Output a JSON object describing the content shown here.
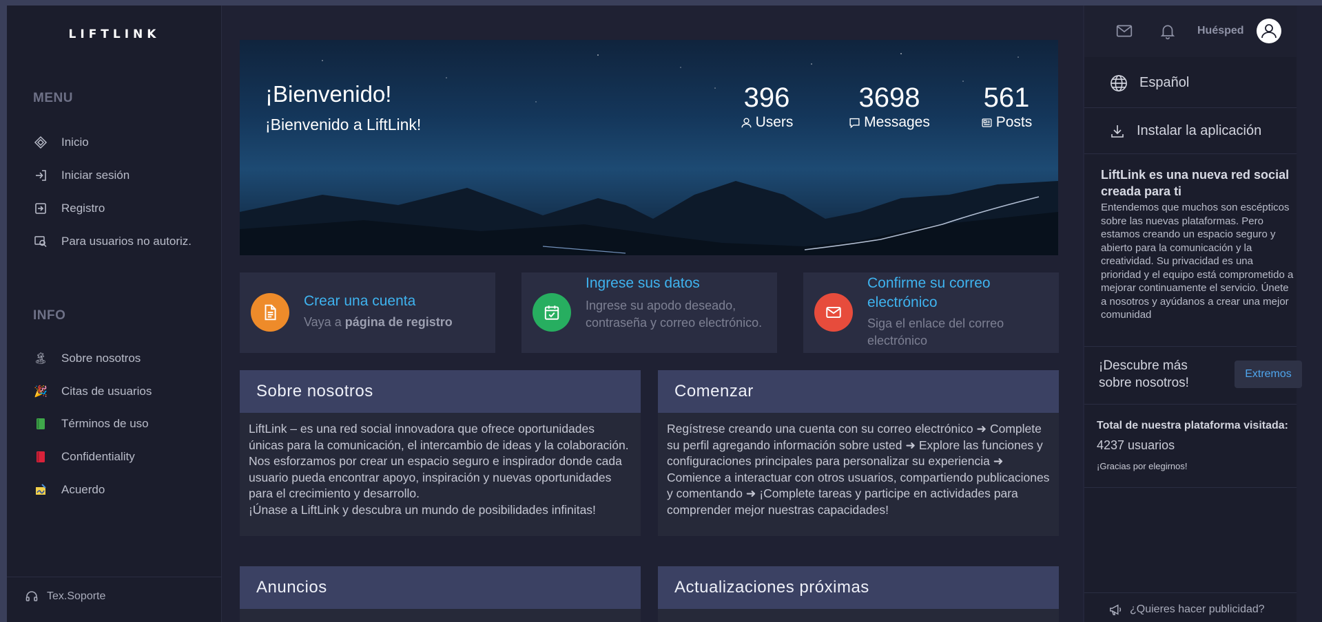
{
  "brand": "LIFTLINK",
  "menu": {
    "title": "MENU",
    "items": [
      {
        "label": "Inicio",
        "icon": "home-diamond-icon"
      },
      {
        "label": "Iniciar sesión",
        "icon": "login-icon"
      },
      {
        "label": "Registro",
        "icon": "register-icon"
      },
      {
        "label": "Para usuarios no autoriz.",
        "icon": "search-window-icon"
      }
    ]
  },
  "info": {
    "title": "INFO",
    "items": [
      {
        "label": "Sobre nosotros",
        "icon": "palm-tree-emoji"
      },
      {
        "label": "Citas de usuarios",
        "icon": "party-popper-emoji"
      },
      {
        "label": "Términos de uso",
        "icon": "green-book-emoji"
      },
      {
        "label": "Confidentiality",
        "icon": "red-book-emoji"
      },
      {
        "label": "Acuerdo",
        "icon": "signed-paper-emoji"
      }
    ]
  },
  "support": "Tex.Soporte",
  "hero": {
    "title": "¡Bienvenido!",
    "subtitle": "¡Bienvenido a LiftLink!",
    "stats": [
      {
        "value": "396",
        "label": "Users"
      },
      {
        "value": "3698",
        "label": "Messages"
      },
      {
        "value": "561",
        "label": "Posts"
      }
    ]
  },
  "steps": [
    {
      "title": "Crear una cuenta",
      "desc_prefix": "Vaya a ",
      "desc_bold": "página de registro",
      "color": "#ee8b2a"
    },
    {
      "title": "Ingrese sus datos",
      "desc": "Ingrese su apodo deseado, contraseña y correo electrónico.",
      "color": "#27ae60"
    },
    {
      "title_line1": "Confirme su correo",
      "title_line2": "electrónico",
      "desc": "Siga el enlace del correo electrónico",
      "color": "#e74c3c"
    }
  ],
  "cards": {
    "about": {
      "title": "Sobre nosotros",
      "body": "LiftLink – es una red social innovadora que ofrece oportunidades únicas para la comunicación, el intercambio de ideas y la colaboración. Nos esforzamos por crear un espacio seguro e inspirador donde cada usuario pueda encontrar apoyo, inspiración y nuevas oportunidades para el crecimiento y desarrollo.",
      "body2": "¡Únase a LiftLink y descubra un mundo de posibilidades infinitas!"
    },
    "start": {
      "title": "Comenzar",
      "body": "Regístrese creando una cuenta con su correo electrónico ➜ Complete su perfil agregando información sobre usted ➜ Explore las funciones y configuraciones principales para personalizar su experiencia ➜ Comience a interactuar con otros usuarios, compartiendo publicaciones y comentando ➜ ¡Complete tareas y participe en actividades para comprender mejor nuestras capacidades!"
    },
    "announcements": {
      "title": "Anuncios"
    },
    "updates": {
      "title": "Actualizaciones próximas"
    }
  },
  "right": {
    "guest": "Huésped",
    "language": "Español",
    "install": "Instalar la aplicación",
    "about_title": "LiftLink es una nueva red social creada para ti",
    "about_body": "Entendemos que muchos son escépticos sobre las nuevas plataformas. Pero estamos creando un espacio seguro y abierto para la comunicación y la creatividad. Su privacidad es una prioridad y el equipo está comprometido a mejorar continuamente el servicio. Únete a nosotros y ayúdanos a crear una mejor comunidad",
    "discover": "¡Descubre más sobre nosotros!",
    "discover_button": "Extremos",
    "visits_title": "Total de nuestra plataforma visitada:",
    "visits_value": "4237 usuarios",
    "thanks": "¡Gracias por elegirnos!",
    "ads": "¿Quieres hacer publicidad?"
  }
}
